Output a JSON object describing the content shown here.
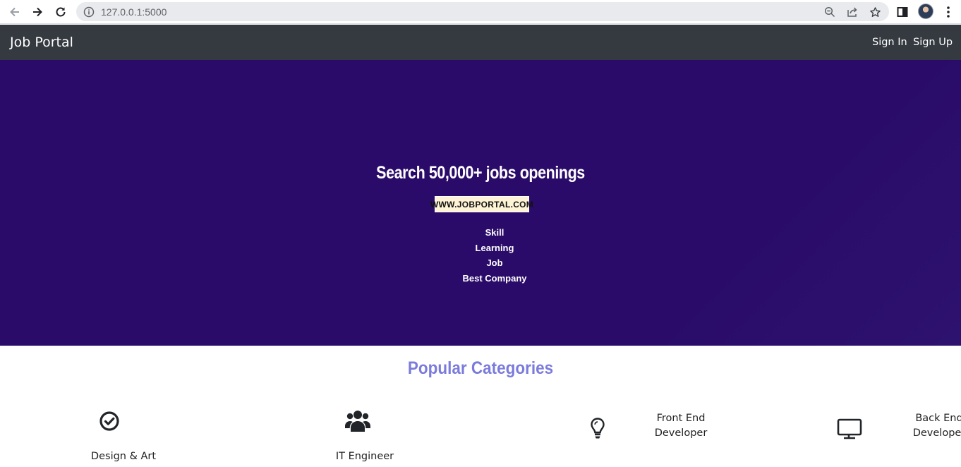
{
  "browser": {
    "url": "127.0.0.1:5000",
    "icons": [
      "back-icon",
      "forward-icon",
      "reload-icon",
      "info-icon",
      "zoom-icon",
      "share-icon",
      "star-icon",
      "sidepanel-icon",
      "avatar",
      "menu-dots-icon"
    ]
  },
  "navbar": {
    "brand": "Job Portal",
    "sign_in": "Sign In",
    "sign_up": "Sign Up",
    "background": "#343a40"
  },
  "hero": {
    "title": "Search 50,000+ jobs openings",
    "badge": "WWW.JOBPORTAL.COM",
    "items": [
      "Skill",
      "Learning",
      "Job",
      "Best Company"
    ],
    "background": "#2a0b69"
  },
  "categories": {
    "title": "Popular Categories",
    "title_color": "#7b7bdc",
    "items": [
      {
        "label": "Design & Art",
        "icon": "check-circle-icon"
      },
      {
        "label": "IT Engineer",
        "icon": "users-icon"
      },
      {
        "label_line1": "Front End",
        "label_line2": "Developer",
        "icon": "lightbulb-icon"
      },
      {
        "label_line1": "Back End",
        "label_line2": "Developer",
        "icon": "monitor-icon"
      }
    ]
  }
}
